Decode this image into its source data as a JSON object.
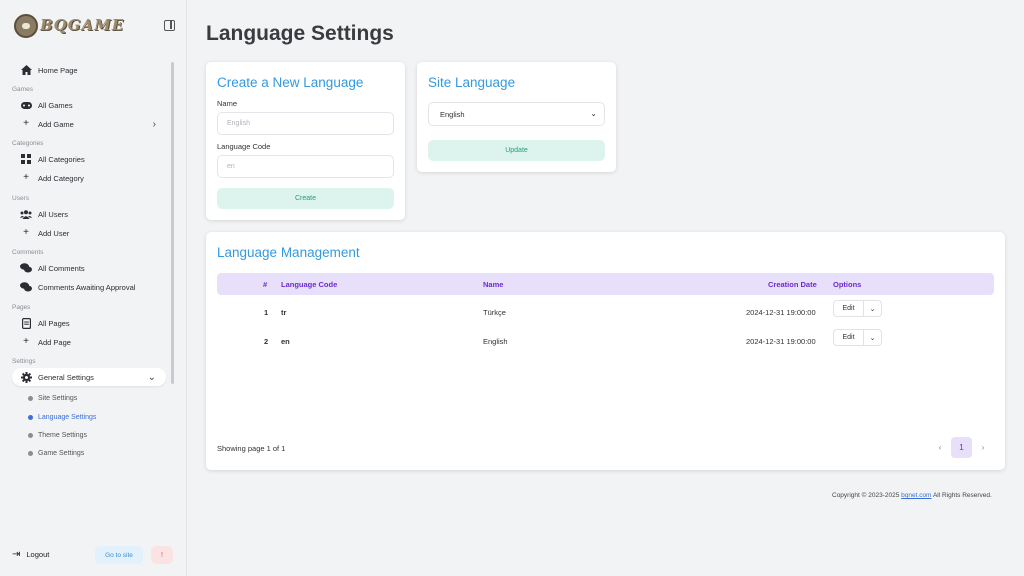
{
  "brand": {
    "logo_text": "BQGAME"
  },
  "sidebar": {
    "home": "Home Page",
    "sections": {
      "games": "Games",
      "categories": "Categories",
      "users": "Users",
      "comments": "Comments",
      "pages": "Pages",
      "settings": "Settings"
    },
    "items": {
      "all_games": "All Games",
      "add_game": "Add Game",
      "all_categories": "All Categories",
      "add_category": "Add Category",
      "all_users": "All Users",
      "add_user": "Add User",
      "all_comments": "All Comments",
      "comments_awaiting": "Comments Awaiting Approval",
      "all_pages": "All Pages",
      "add_page": "Add Page",
      "general_settings": "General Settings"
    },
    "submenu": {
      "site_settings": "Site Settings",
      "language_settings": "Language Settings",
      "theme_settings": "Theme Settings",
      "game_settings": "Game Settings"
    },
    "logout": "Logout",
    "go_to_site": "Go to site",
    "alert": "!"
  },
  "page": {
    "title": "Language Settings"
  },
  "create_card": {
    "title": "Create a New Language",
    "name_label": "Name",
    "name_placeholder": "English",
    "code_label": "Language Code",
    "code_placeholder": "en",
    "button": "Create"
  },
  "site_language_card": {
    "title": "Site Language",
    "selected": "English",
    "button": "Update"
  },
  "management": {
    "title": "Language Management",
    "columns": [
      "#",
      "Language Code",
      "Name",
      "Creation Date",
      "Options"
    ],
    "rows": [
      {
        "num": "1",
        "code": "tr",
        "name": "Türkçe",
        "date": "2024-12-31 19:00:00",
        "edit": "Edit"
      },
      {
        "num": "2",
        "code": "en",
        "name": "English",
        "date": "2024-12-31 19:00:00",
        "edit": "Edit"
      }
    ],
    "showing": "Showing page 1 of 1",
    "pagination": {
      "prev": "‹",
      "current": "1",
      "next": "›"
    }
  },
  "footer": {
    "prefix": "Copyright © 2023-2025",
    "link": "bqnet.com",
    "suffix": "All Rights Reserved."
  },
  "colors": {
    "accent_blue": "#3599e0",
    "table_header_bg": "#e8e0fa",
    "table_header_text": "#6a2bd0",
    "button_green_bg": "#dcf3ee",
    "button_green_text": "#25a06e",
    "active_sub": "#3b6fd8"
  },
  "icons": {
    "home": "home-icon",
    "games": "gamepad-icon",
    "add": "plus-icon",
    "categories": "grid-icon",
    "users": "users-icon",
    "comments": "comments-icon",
    "pages": "document-icon",
    "settings": "gear-icon",
    "logout": "logout-icon",
    "chevron": "chevron-icon"
  }
}
